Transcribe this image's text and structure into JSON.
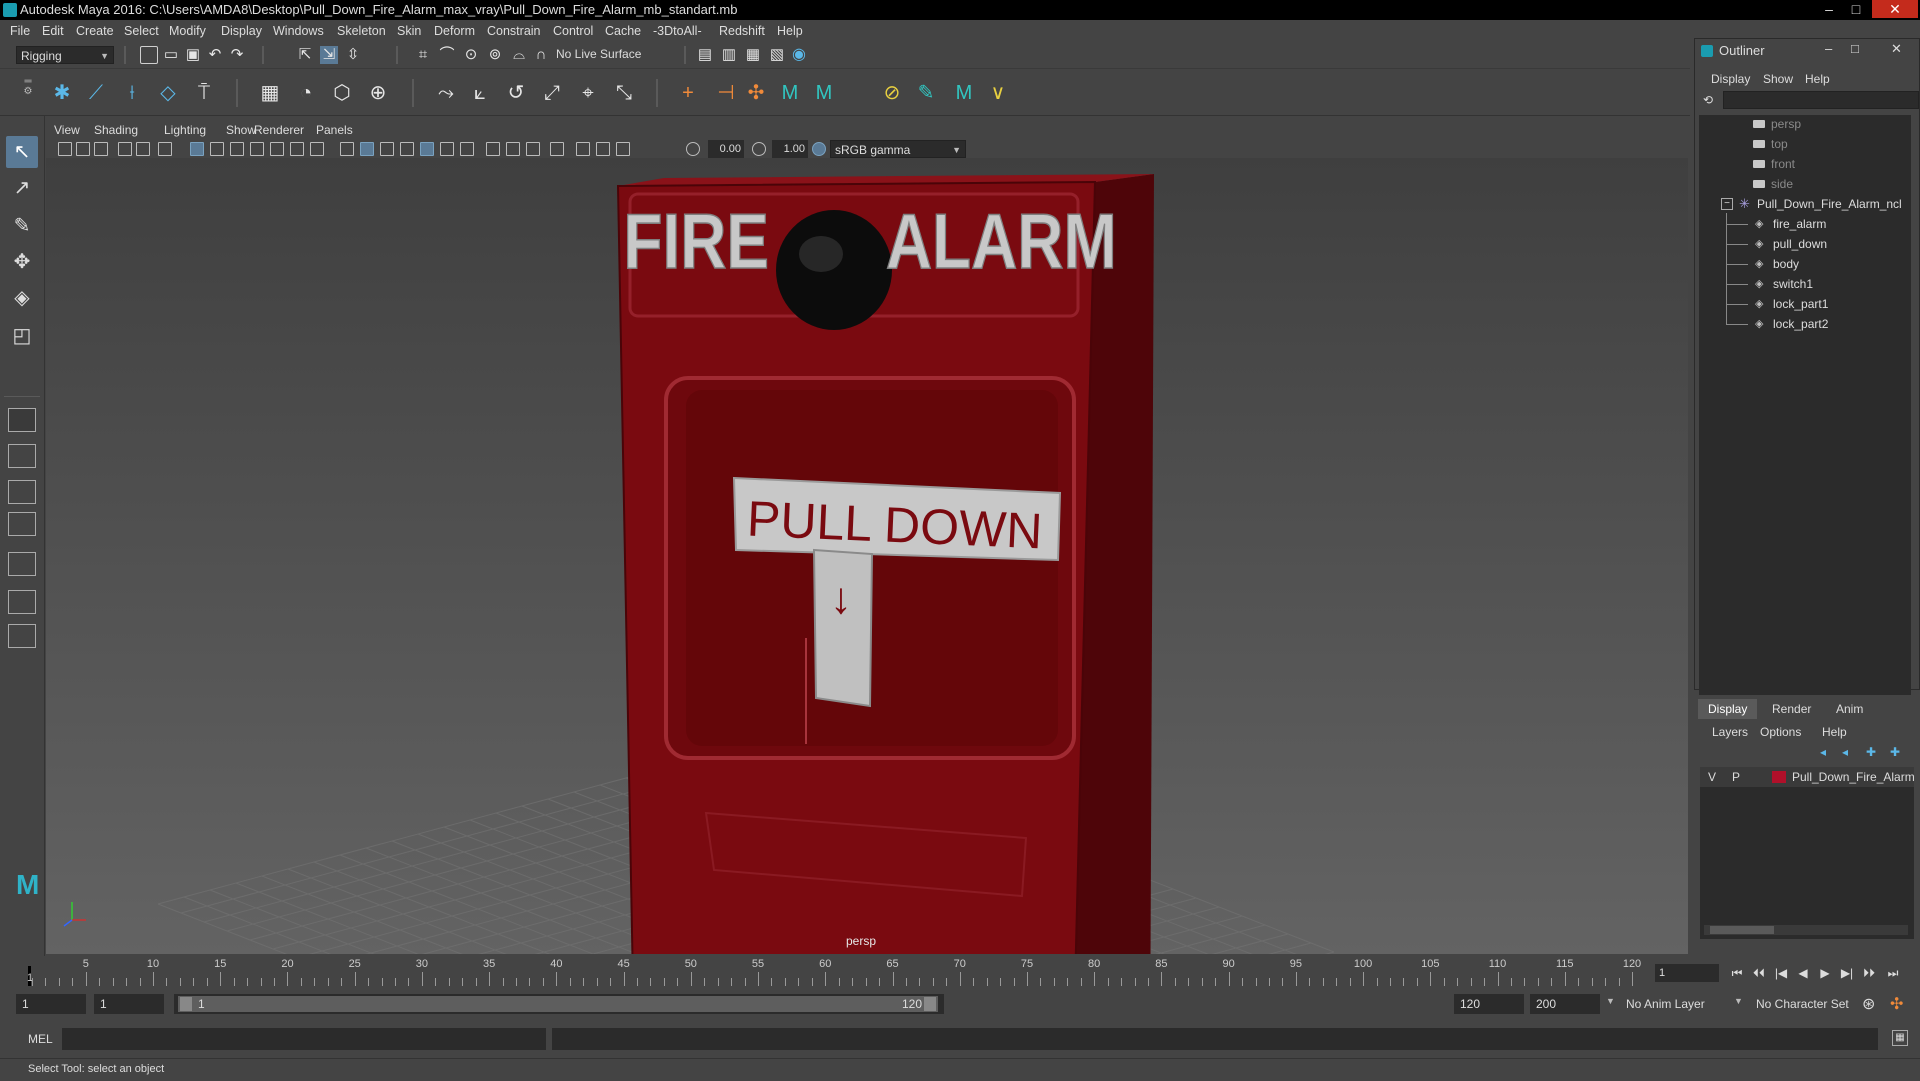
{
  "window": {
    "title": "Autodesk Maya 2016: C:\\Users\\AMDA8\\Desktop\\Pull_Down_Fire_Alarm_max_vray\\Pull_Down_Fire_Alarm_mb_standart.mb",
    "minimize": "–",
    "maximize": "□",
    "close": "✕"
  },
  "menubar": [
    "File",
    "Edit",
    "Create",
    "Select",
    "Modify",
    "Display",
    "Windows",
    "Skeleton",
    "Skin",
    "Deform",
    "Constrain",
    "Control",
    "Cache",
    "-3DtoAll-",
    "Redshift",
    "Help"
  ],
  "statusline": {
    "menu_set": "Rigging",
    "live_surface": "No Live Surface"
  },
  "viewport": {
    "menu": [
      "View",
      "Shading",
      "Lighting",
      "Show",
      "Renderer",
      "Panels"
    ],
    "exposure": "0.00",
    "gamma": "1.00",
    "color_space": "sRGB gamma",
    "camera_label": "persp",
    "model_text": {
      "fire": "FIRE",
      "alarm": "ALARM",
      "pull_down": "PULL  DOWN",
      "arrow": "↓"
    },
    "colors": {
      "body": "#7a0a10",
      "body_dark": "#4e0509",
      "handle": "#c8c8c8",
      "bell": "#0c0c0c"
    }
  },
  "outliner": {
    "title": "Outliner",
    "menu": [
      "Display",
      "Show",
      "Help"
    ],
    "cameras": [
      "persp",
      "top",
      "front",
      "side"
    ],
    "group": "Pull_Down_Fire_Alarm_ncl",
    "group_toggle": "−",
    "children": [
      "fire_alarm",
      "pull_down",
      "body",
      "switch1",
      "lock_part1",
      "lock_part2"
    ],
    "minimize": "–",
    "maximize": "□",
    "close": "✕"
  },
  "layer_editor": {
    "tabs": [
      "Display",
      "Render",
      "Anim"
    ],
    "menu": [
      "Layers",
      "Options",
      "Help"
    ],
    "layer": {
      "v": "V",
      "p": "P",
      "name": "Pull_Down_Fire_Alarm",
      "color": "#b0102a"
    }
  },
  "timeslider": {
    "tick_labels": [
      "5",
      "10",
      "15",
      "20",
      "25",
      "30",
      "35",
      "40",
      "45",
      "50",
      "55",
      "60",
      "65",
      "70",
      "75",
      "80",
      "85",
      "90",
      "95",
      "100",
      "105",
      "110",
      "115",
      "120"
    ],
    "start_label": "1",
    "current_frame": "1",
    "playback": [
      "⏮",
      "⏴⏴",
      "|◀",
      "◀",
      "▶",
      "▶|",
      "⏵⏵",
      "⏭"
    ]
  },
  "rangeslider": {
    "start": "1",
    "playback_start": "1",
    "range_left": "1",
    "range_right": "120",
    "playback_end": "120",
    "end": "200",
    "anim_layer": "No Anim Layer",
    "char_set": "No Character Set"
  },
  "cmdline": {
    "label": "MEL"
  },
  "help": {
    "text": "Select Tool: select an object"
  }
}
